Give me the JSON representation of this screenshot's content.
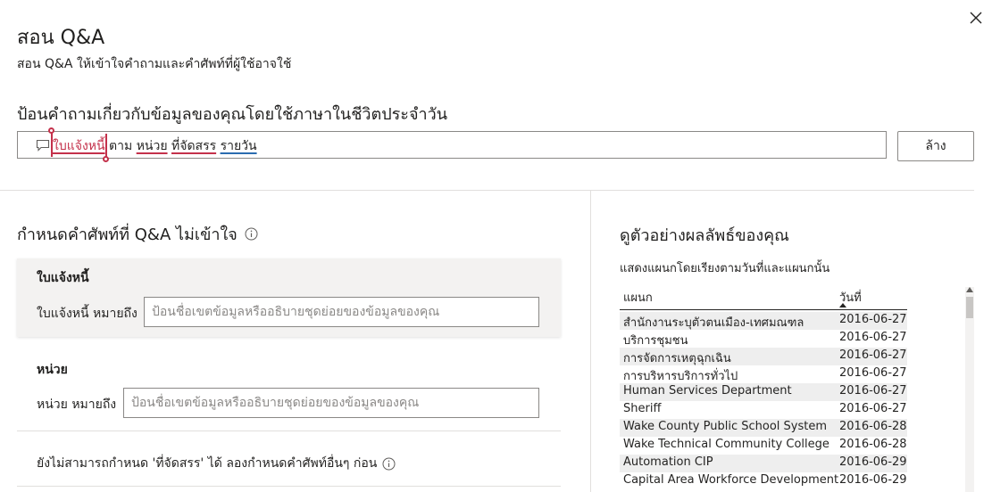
{
  "dialog": {
    "title": "สอน Q&A",
    "subtitle": "สอน Q&A ให้เข้าใจคำถามและคำศัพท์ที่ผู้ใช้อาจใช้",
    "close_icon": "close-icon"
  },
  "question": {
    "prompt": "ป้อนคำถามเกี่ยวกับข้อมูลของคุณโดยใช้ภาษาในชีวิตประจำวัน",
    "icon": "speech-bubble-icon",
    "tokens": {
      "t1": "ใบแจ้งหนี้",
      "t2": "ตาม",
      "t3": "หน่วย",
      "t4": "ที่จัดสรร",
      "t5": "รายวัน"
    },
    "clear_label": "ล้าง"
  },
  "define_terms": {
    "title": "กำหนดคำศัพท์ที่ Q&A ไม่เข้าใจ",
    "info_icon": "info-icon",
    "terms": [
      {
        "name": "ใบแจ้งหนี้",
        "label": "ใบแจ้งหนี้ หมายถึง",
        "placeholder": "ป้อนชื่อเขตข้อมูลหรืออธิบายชุดย่อยของข้อมูลของคุณ"
      },
      {
        "name": "หน่วย",
        "label": "หน่วย หมายถึง",
        "placeholder": "ป้อนชื่อเขตข้อมูลหรืออธิบายชุดย่อยของข้อมูลของคุณ"
      }
    ],
    "cannot_define": "ยังไม่สามารถกำหนด 'ที่จัดสรร' ได้ ลองกำหนดคำศัพท์อื่นๆ ก่อน"
  },
  "preview": {
    "title": "ดูตัวอย่างผลลัพธ์ของคุณ",
    "subtitle": "แสดงแผนกโดยเรียงตามวันที่และแผนกนั้น",
    "columns": [
      "แผนก",
      "วันที่"
    ],
    "rows": [
      [
        "สำนักงานระบุตัวตนเมือง-เทศมณฑล",
        "2016-06-27"
      ],
      [
        "บริการชุมชน",
        "2016-06-27"
      ],
      [
        "การจัดการเหตุฉุกเฉิน",
        "2016-06-27"
      ],
      [
        "การบริหารบริการทั่วไป",
        "2016-06-27"
      ],
      [
        "Human Services Department",
        "2016-06-27"
      ],
      [
        "Sheriff",
        "2016-06-27"
      ],
      [
        "Wake County Public School System",
        "2016-06-28"
      ],
      [
        "Wake Technical Community College",
        "2016-06-28"
      ],
      [
        "Automation CIP",
        "2016-06-29"
      ],
      [
        "Capital Area Workforce Development",
        "2016-06-29"
      ]
    ]
  },
  "colors": {
    "error_underline": "#c4314b",
    "ok_underline": "#2b6cb0",
    "border": "#8a8886",
    "card_bg": "#f3f2f1"
  }
}
